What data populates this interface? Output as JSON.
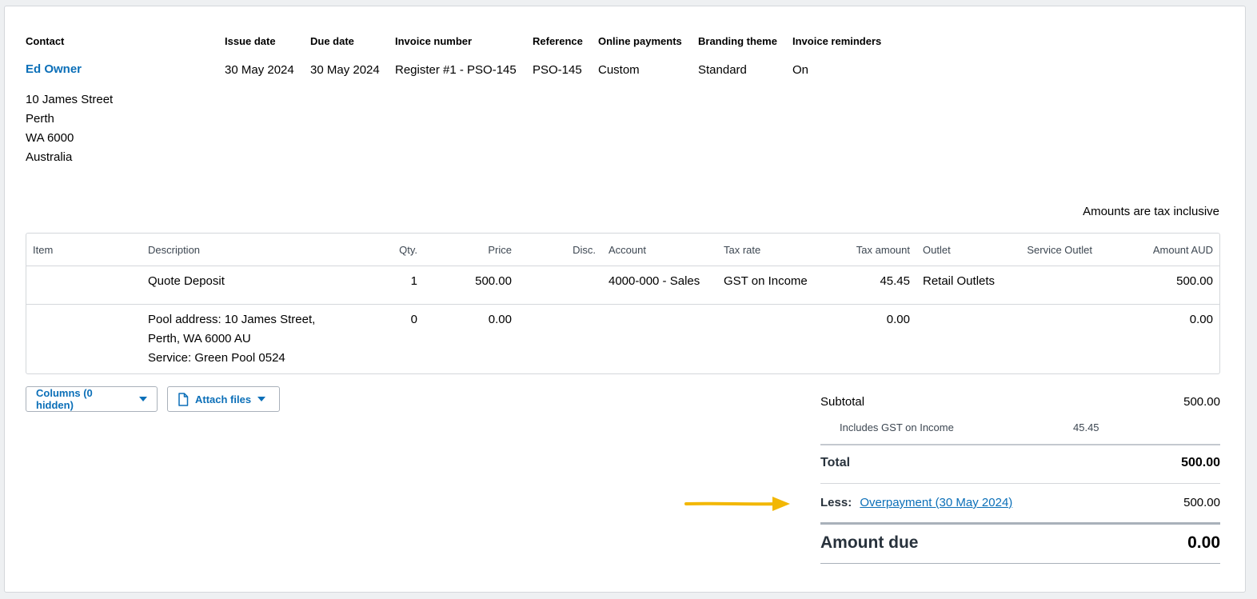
{
  "header": {
    "contact_label": "Contact",
    "contact_name": "Ed Owner",
    "address": [
      "10 James Street",
      "Perth",
      "WA 6000",
      "Australia"
    ],
    "fields": [
      {
        "label": "Issue date",
        "value": "30 May 2024"
      },
      {
        "label": "Due date",
        "value": "30 May 2024"
      },
      {
        "label": "Invoice number",
        "value": "Register #1 - PSO-145"
      },
      {
        "label": "Reference",
        "value": "PSO-145"
      },
      {
        "label": "Online payments",
        "value": "Custom"
      },
      {
        "label": "Branding theme",
        "value": "Standard"
      },
      {
        "label": "Invoice reminders",
        "value": "On"
      }
    ]
  },
  "tax_note": "Amounts are tax inclusive",
  "table": {
    "columns": [
      "Item",
      "Description",
      "Qty.",
      "Price",
      "Disc.",
      "Account",
      "Tax rate",
      "Tax amount",
      "Outlet",
      "Service Outlet",
      "Amount AUD"
    ],
    "rows": [
      {
        "item": "",
        "description": [
          "Quote Deposit"
        ],
        "qty": "1",
        "price": "500.00",
        "disc": "",
        "account": "4000-000 - Sales",
        "tax_rate": "GST on Income",
        "tax_amount": "45.45",
        "outlet": "Retail Outlets",
        "service_outlet": "",
        "amount": "500.00"
      },
      {
        "item": "",
        "description": [
          "Pool address: 10 James Street,",
          "Perth, WA 6000 AU",
          "Service: Green Pool 0524"
        ],
        "qty": "0",
        "price": "0.00",
        "disc": "",
        "account": "",
        "tax_rate": "",
        "tax_amount": "0.00",
        "outlet": "",
        "service_outlet": "",
        "amount": "0.00"
      }
    ]
  },
  "buttons": {
    "columns": "Columns (0 hidden)",
    "attach": "Attach files"
  },
  "totals": {
    "subtotal_label": "Subtotal",
    "subtotal_value": "500.00",
    "gst_label": "Includes GST on Income",
    "gst_value": "45.45",
    "total_label": "Total",
    "total_value": "500.00",
    "less_label": "Less:",
    "less_link": "Overpayment (30 May 2024)",
    "less_value": "500.00",
    "amount_due_label": "Amount due",
    "amount_due_value": "0.00"
  },
  "colors": {
    "accent": "#0b6fb8",
    "arrow": "#f2b705"
  }
}
